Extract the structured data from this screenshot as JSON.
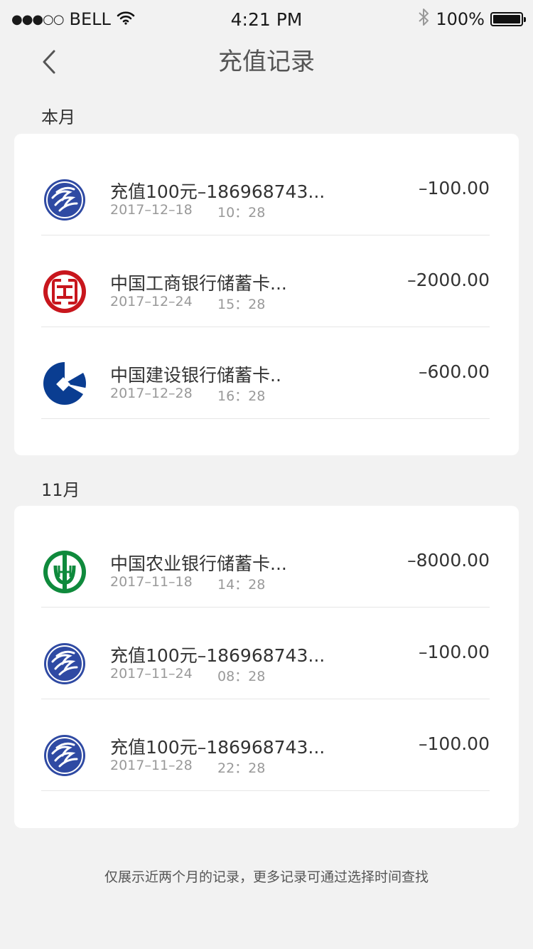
{
  "status_bar": {
    "carrier": "BELL",
    "signal": "●●●○○",
    "time": "4:21 PM",
    "bluetooth": "bluetooth-icon",
    "battery_text": "100%",
    "battery_level": 1.0
  },
  "nav": {
    "title": "充值记录",
    "back_icon": "chevron-left-icon"
  },
  "sections": [
    {
      "label": "本月",
      "records": [
        {
          "logo": "china-mobile-logo",
          "title": "充值100元–186968743...",
          "date": "2017–12–18",
          "time": "10：28",
          "amount": "–100.00"
        },
        {
          "logo": "icbc-logo",
          "title": "中国工商银行储蓄卡...",
          "date": "2017–12–24",
          "time": "15：28",
          "amount": "–2000.00"
        },
        {
          "logo": "ccb-logo",
          "title": "中国建设银行储蓄卡..",
          "date": "2017–12–28",
          "time": "16：28",
          "amount": "–600.00"
        }
      ]
    },
    {
      "label": "11月",
      "records": [
        {
          "logo": "abc-logo",
          "title": "中国农业银行储蓄卡...",
          "date": "2017–11–18",
          "time": "14：28",
          "amount": "–8000.00"
        },
        {
          "logo": "china-mobile-logo",
          "title": "充值100元–186968743...",
          "date": "2017–11–24",
          "time": "08：28",
          "amount": "–100.00"
        },
        {
          "logo": "china-mobile-logo",
          "title": "充值100元–186968743...",
          "date": "2017–11–28",
          "time": "22：28",
          "amount": "–100.00"
        }
      ]
    }
  ],
  "footer_note": "仅展示近两个月的记录，更多记录可通过选择时间查找",
  "colors": {
    "background": "#f2f2f2",
    "china_mobile": "#2f4aa3",
    "icbc": "#c8161d",
    "ccb": "#0a3d91",
    "abc": "#0f8a3c"
  }
}
